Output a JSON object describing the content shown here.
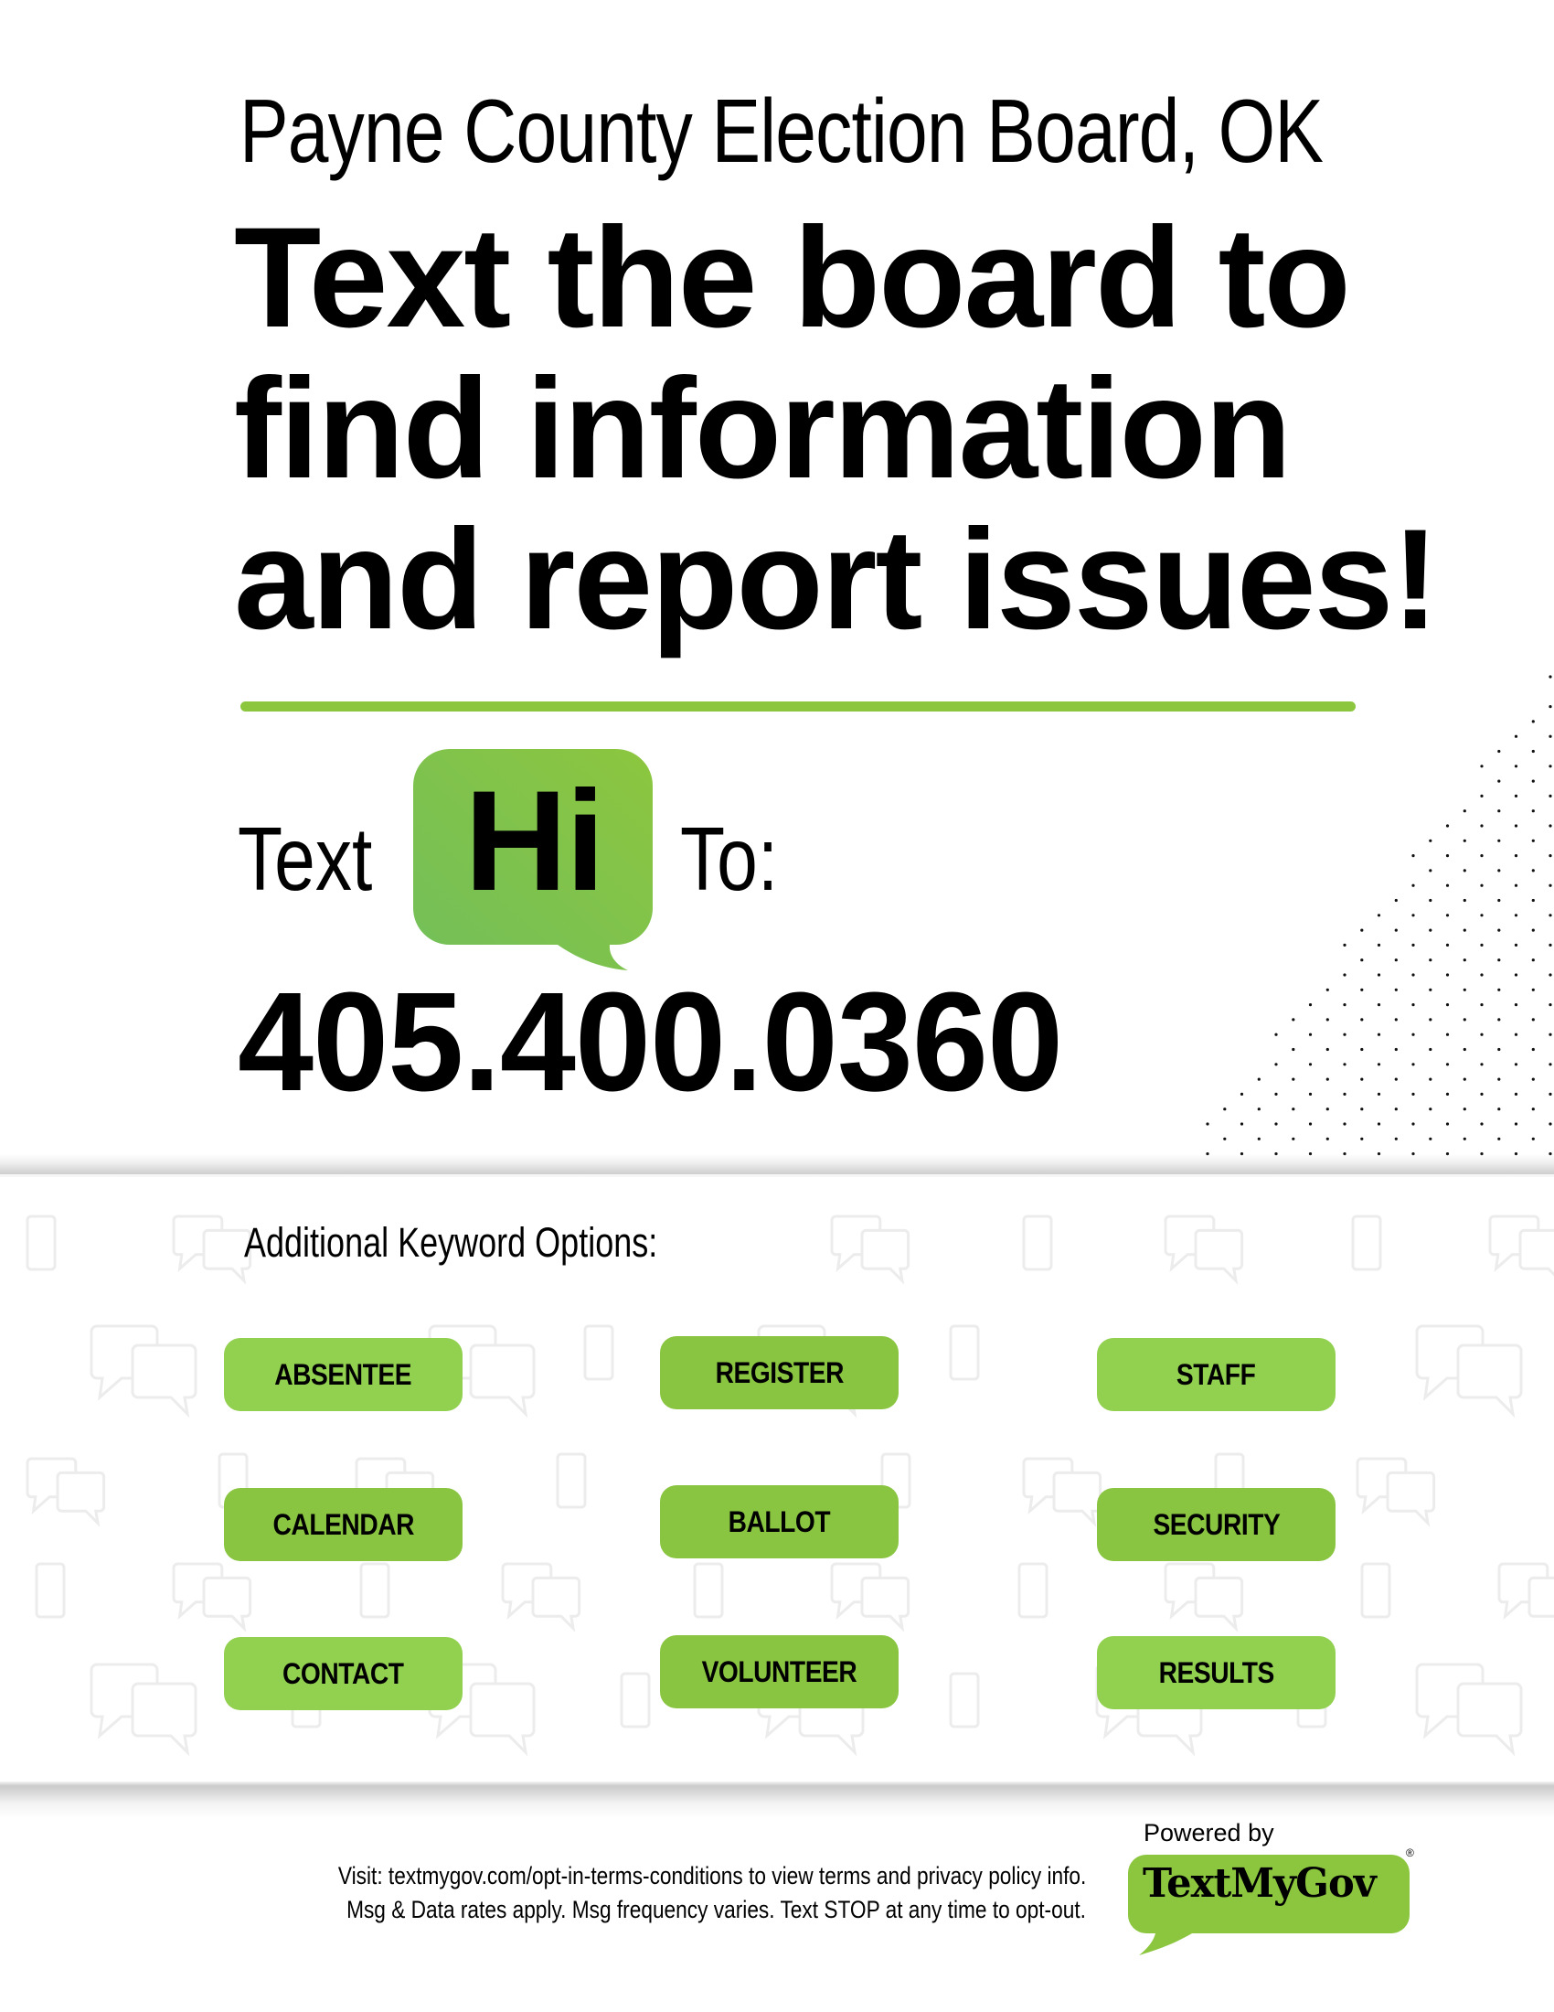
{
  "header": {
    "org_title": "Payne County Election Board, OK",
    "headline_lines": [
      "Text the board to",
      "find information",
      "and report issues!"
    ]
  },
  "cta": {
    "text_prefix": "Text",
    "keyword": "Hi",
    "text_suffix": "To:",
    "phone_number": "405.400.0360",
    "bubble_icon": "speech-bubble-icon"
  },
  "keywords": {
    "heading": "Additional Keyword Options:",
    "items": [
      {
        "label": "ABSENTEE",
        "color": "#92d050"
      },
      {
        "label": "REGISTER",
        "color": "#8ac541"
      },
      {
        "label": "STAFF",
        "color": "#92d050"
      },
      {
        "label": "CALENDAR",
        "color": "#8ac541"
      },
      {
        "label": "BALLOT",
        "color": "#8ac541"
      },
      {
        "label": "SECURITY",
        "color": "#8ac541"
      },
      {
        "label": "CONTACT",
        "color": "#92d050"
      },
      {
        "label": "VOLUNTEER",
        "color": "#8ac541"
      },
      {
        "label": "RESULTS",
        "color": "#92d050"
      }
    ],
    "background_icons": [
      "phone-outline-icon",
      "chat-bubbles-icon"
    ]
  },
  "footer": {
    "line1": "Visit: textmygov.com/opt-in-terms-conditions to view terms and privacy policy info.",
    "line2": "Msg & Data rates apply. Msg frequency varies. Text STOP at any time to opt-out.",
    "powered_by": "Powered by",
    "logo_text": "TextMyGov",
    "registered_mark": "®"
  },
  "colors": {
    "accent_green": "#8cc63f",
    "bubble_green_light": "#8dc63f",
    "bubble_green_dark": "#72bf5a",
    "logo_green": "#8cc63f",
    "text": "#000000"
  }
}
